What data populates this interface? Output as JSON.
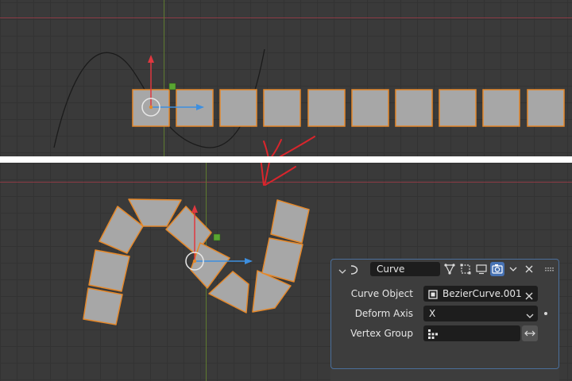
{
  "modifier_panel": {
    "name_value": "Curve",
    "fields": {
      "curve_object_label": "Curve Object",
      "curve_object_value": "BezierCurve.001",
      "deform_axis_label": "Deform Axis",
      "deform_axis_value": "X",
      "vertex_group_label": "Vertex Group",
      "vertex_group_value": ""
    },
    "icons": [
      "chevron-down-icon",
      "curve-modifier-icon",
      "edit-mode-icon",
      "cage-icon",
      "viewport-display-icon",
      "render-icon",
      "chevron-down-icon",
      "close-icon",
      "drag-handle-icon"
    ]
  },
  "colors": {
    "viewport_bg": "#3a3a3a",
    "selection_orange": "#e5882a",
    "face_gray": "#a7a7a7",
    "x_axis": "#8a3a44",
    "y_axis": "#5e7a2f",
    "gizmo_x_red": "#e0373f",
    "gizmo_y_blue": "#3d8fe0",
    "annotation_red": "#d9252c",
    "panel_accent": "#4772b3"
  }
}
